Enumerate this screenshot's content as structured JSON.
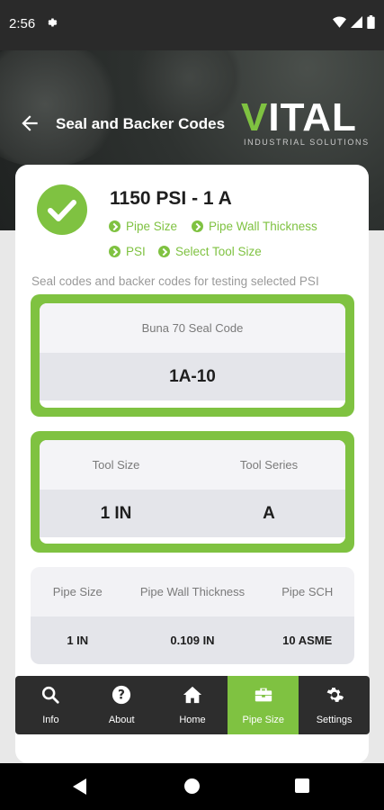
{
  "status_bar": {
    "time": "2:56"
  },
  "header": {
    "title": "Seal and Backer Codes",
    "logo_main": "ITAL",
    "logo_v": "V",
    "logo_sub": "INDUSTRIAL SOLUTIONS"
  },
  "result": {
    "title": "1150 PSI - 1 A",
    "crumbs": [
      "Pipe Size",
      "Pipe Wall Thickness",
      "PSI",
      "Select Tool Size"
    ],
    "description": "Seal codes and backer codes for testing selected PSI"
  },
  "seal": {
    "header": "Buna 70 Seal Code",
    "value": "1A-10"
  },
  "tool": {
    "headers": [
      "Tool Size",
      "Tool Series"
    ],
    "values": [
      "1 IN",
      "A"
    ]
  },
  "pipe": {
    "headers": [
      "Pipe Size",
      "Pipe Wall Thickness",
      "Pipe SCH"
    ],
    "values": [
      "1 IN",
      "0.109 IN",
      "10 ASME"
    ]
  },
  "nav": {
    "items": [
      {
        "label": "Info",
        "icon": "search-icon"
      },
      {
        "label": "About",
        "icon": "help-icon"
      },
      {
        "label": "Home",
        "icon": "home-icon"
      },
      {
        "label": "Pipe Size",
        "icon": "toolbox-icon",
        "active": true
      },
      {
        "label": "Settings",
        "icon": "gear-icon"
      }
    ]
  },
  "colors": {
    "accent": "#7fc241",
    "dark": "#2d2d2d"
  }
}
